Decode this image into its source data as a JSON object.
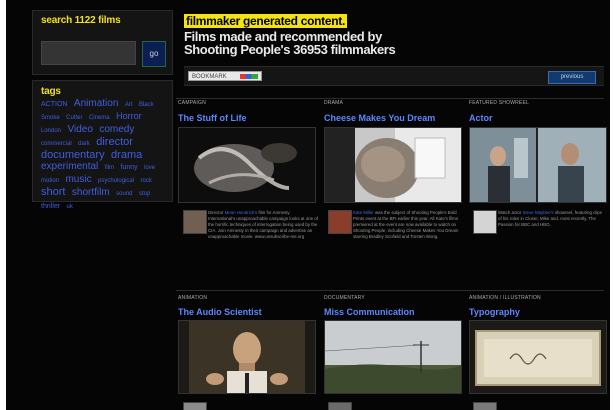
{
  "search": {
    "title": "search 1122 films",
    "go_label": "go"
  },
  "tags": {
    "title": "tags",
    "items": [
      {
        "label": "ACTION",
        "size": 7
      },
      {
        "label": "Animation",
        "size": 10
      },
      {
        "label": "Art",
        "size": 6
      },
      {
        "label": "Black",
        "size": 6
      },
      {
        "label": "Smoke",
        "size": 6
      },
      {
        "label": "Cutter",
        "size": 6
      },
      {
        "label": "Cinema",
        "size": 6
      },
      {
        "label": "Horror",
        "size": 9
      },
      {
        "label": "London",
        "size": 6
      },
      {
        "label": "Video",
        "size": 10
      },
      {
        "label": "comedy",
        "size": 10
      },
      {
        "label": "commercial",
        "size": 6
      },
      {
        "label": "dark",
        "size": 6
      },
      {
        "label": "director",
        "size": 11
      },
      {
        "label": "documentary",
        "size": 11
      },
      {
        "label": "drama",
        "size": 11
      },
      {
        "label": "experimental",
        "size": 10
      },
      {
        "label": "film",
        "size": 6
      },
      {
        "label": "funny",
        "size": 7
      },
      {
        "label": "love",
        "size": 6
      },
      {
        "label": "motion",
        "size": 6
      },
      {
        "label": "music",
        "size": 10
      },
      {
        "label": "psychological",
        "size": 6
      },
      {
        "label": "rock",
        "size": 6
      },
      {
        "label": "short",
        "size": 11
      },
      {
        "label": "shortfilm",
        "size": 10
      },
      {
        "label": "sound",
        "size": 6
      },
      {
        "label": "stop",
        "size": 6
      },
      {
        "label": "thriller",
        "size": 7
      },
      {
        "label": "uk",
        "size": 6
      }
    ]
  },
  "header": {
    "highlight": "filmmaker generated content.",
    "line1": "Films made and recommended by",
    "line2": "Shooting People's 36953 filmmakers"
  },
  "toolbar": {
    "share_label": "BOOKMARK",
    "prev_label": "previous"
  },
  "films": [
    {
      "category": "CAMPAIGN",
      "title": "The Stuff of Life",
      "desc_name": "Mean Hendrick's",
      "desc_pre": "Director",
      "desc": " film for Amnesty International's unapproachable campaign looks at one of the horrific techniques of interrogation being used by the CIA. Join Amnesty in their campaign and advertise an unapproachable movie. www.unsubscribe-me.org"
    },
    {
      "category": "DRAMA",
      "title": "Cheese Makes You Dream",
      "desc_name": "Kate Miller",
      "desc_pre": "",
      "desc": " was the subject of Shooting People's Bold Prints event at the BFI earlier this year. All Kate's films premiered at the event are now available to watch on Shooting People, including Cheese Makes You Dream starring Bradley Scofield and Torsten Wong."
    },
    {
      "category": "FEATURED SHOWREEL",
      "title": "Actor",
      "desc_name": "Steve Maybee's",
      "desc_pre": "Watch actor",
      "desc": " showreel, featuring clips of his roles in Closer, Mike and, most recently, The Passion for BBC and HBO."
    },
    {
      "category": "ANIMATION",
      "title": "The Audio Scientist"
    },
    {
      "category": "DOCUMENTARY",
      "title": "Miss Communication"
    },
    {
      "category": "ANIMATION / ILLUSTRATION",
      "title": "Typography"
    }
  ],
  "colors": {
    "highlight": "#f4e314",
    "link": "#5f86ff",
    "tag": "#3f5ee0",
    "background": "#050505"
  }
}
